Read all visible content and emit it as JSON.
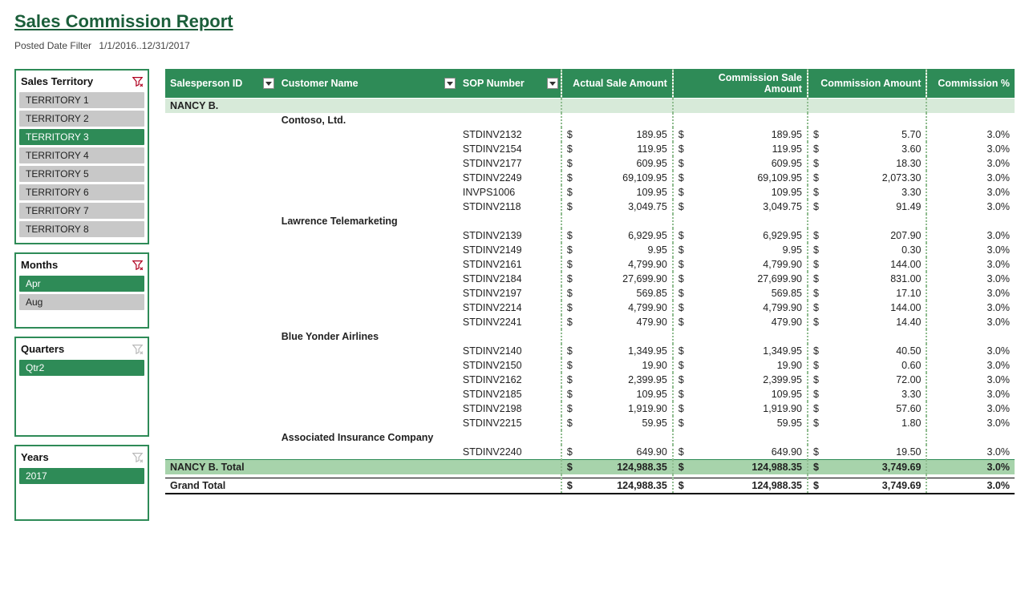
{
  "title": "Sales Commission Report",
  "filter": {
    "label": "Posted Date Filter",
    "value": "1/1/2016..12/31/2017"
  },
  "slicers": [
    {
      "title": "Sales Territory",
      "active_clear": true,
      "tall": false,
      "items": [
        {
          "label": "TERRITORY 1",
          "sel": false
        },
        {
          "label": "TERRITORY 2",
          "sel": false
        },
        {
          "label": "TERRITORY 3",
          "sel": true
        },
        {
          "label": "TERRITORY 4",
          "sel": false
        },
        {
          "label": "TERRITORY 5",
          "sel": false
        },
        {
          "label": "TERRITORY 6",
          "sel": false
        },
        {
          "label": "TERRITORY 7",
          "sel": false
        },
        {
          "label": "TERRITORY 8",
          "sel": false
        }
      ]
    },
    {
      "title": "Months",
      "active_clear": true,
      "tall": false,
      "items": [
        {
          "label": "Apr",
          "sel": true
        },
        {
          "label": "Aug",
          "sel": false
        }
      ],
      "short": true
    },
    {
      "title": "Quarters",
      "active_clear": false,
      "tall": true,
      "items": [
        {
          "label": "Qtr2",
          "sel": true
        }
      ]
    },
    {
      "title": "Years",
      "active_clear": false,
      "tall": false,
      "items": [
        {
          "label": "2017",
          "sel": true
        }
      ],
      "short": true
    }
  ],
  "columns": {
    "salesperson": "Salesperson ID",
    "customer": "Customer Name",
    "sop": "SOP Number",
    "actual": "Actual Sale Amount",
    "comm_sale": "Commission Sale Amount",
    "comm_amt": "Commission Amount",
    "comm_pct": "Commission %"
  },
  "sp_name": "NANCY B.",
  "customers": [
    {
      "name": "Contoso, Ltd.",
      "rows": [
        {
          "sop": "STDINV2132",
          "actual": "189.95",
          "csale": "189.95",
          "camt": "5.70",
          "pct": "3.0%"
        },
        {
          "sop": "STDINV2154",
          "actual": "119.95",
          "csale": "119.95",
          "camt": "3.60",
          "pct": "3.0%"
        },
        {
          "sop": "STDINV2177",
          "actual": "609.95",
          "csale": "609.95",
          "camt": "18.30",
          "pct": "3.0%"
        },
        {
          "sop": "STDINV2249",
          "actual": "69,109.95",
          "csale": "69,109.95",
          "camt": "2,073.30",
          "pct": "3.0%"
        },
        {
          "sop": "INVPS1006",
          "actual": "109.95",
          "csale": "109.95",
          "camt": "3.30",
          "pct": "3.0%"
        },
        {
          "sop": "STDINV2118",
          "actual": "3,049.75",
          "csale": "3,049.75",
          "camt": "91.49",
          "pct": "3.0%"
        }
      ]
    },
    {
      "name": "Lawrence Telemarketing",
      "rows": [
        {
          "sop": "STDINV2139",
          "actual": "6,929.95",
          "csale": "6,929.95",
          "camt": "207.90",
          "pct": "3.0%"
        },
        {
          "sop": "STDINV2149",
          "actual": "9.95",
          "csale": "9.95",
          "camt": "0.30",
          "pct": "3.0%"
        },
        {
          "sop": "STDINV2161",
          "actual": "4,799.90",
          "csale": "4,799.90",
          "camt": "144.00",
          "pct": "3.0%"
        },
        {
          "sop": "STDINV2184",
          "actual": "27,699.90",
          "csale": "27,699.90",
          "camt": "831.00",
          "pct": "3.0%"
        },
        {
          "sop": "STDINV2197",
          "actual": "569.85",
          "csale": "569.85",
          "camt": "17.10",
          "pct": "3.0%"
        },
        {
          "sop": "STDINV2214",
          "actual": "4,799.90",
          "csale": "4,799.90",
          "camt": "144.00",
          "pct": "3.0%"
        },
        {
          "sop": "STDINV2241",
          "actual": "479.90",
          "csale": "479.90",
          "camt": "14.40",
          "pct": "3.0%"
        }
      ]
    },
    {
      "name": "Blue Yonder Airlines",
      "rows": [
        {
          "sop": "STDINV2140",
          "actual": "1,349.95",
          "csale": "1,349.95",
          "camt": "40.50",
          "pct": "3.0%"
        },
        {
          "sop": "STDINV2150",
          "actual": "19.90",
          "csale": "19.90",
          "camt": "0.60",
          "pct": "3.0%"
        },
        {
          "sop": "STDINV2162",
          "actual": "2,399.95",
          "csale": "2,399.95",
          "camt": "72.00",
          "pct": "3.0%"
        },
        {
          "sop": "STDINV2185",
          "actual": "109.95",
          "csale": "109.95",
          "camt": "3.30",
          "pct": "3.0%"
        },
        {
          "sop": "STDINV2198",
          "actual": "1,919.90",
          "csale": "1,919.90",
          "camt": "57.60",
          "pct": "3.0%"
        },
        {
          "sop": "STDINV2215",
          "actual": "59.95",
          "csale": "59.95",
          "camt": "1.80",
          "pct": "3.0%"
        }
      ]
    },
    {
      "name": "Associated Insurance Company",
      "rows": [
        {
          "sop": "STDINV2240",
          "actual": "649.90",
          "csale": "649.90",
          "camt": "19.50",
          "pct": "3.0%"
        }
      ]
    }
  ],
  "subtotal": {
    "label": "NANCY B. Total",
    "actual": "124,988.35",
    "csale": "124,988.35",
    "camt": "3,749.69",
    "pct": "3.0%"
  },
  "grand": {
    "label": "Grand Total",
    "actual": "124,988.35",
    "csale": "124,988.35",
    "camt": "3,749.69",
    "pct": "3.0%"
  },
  "currency": "$"
}
